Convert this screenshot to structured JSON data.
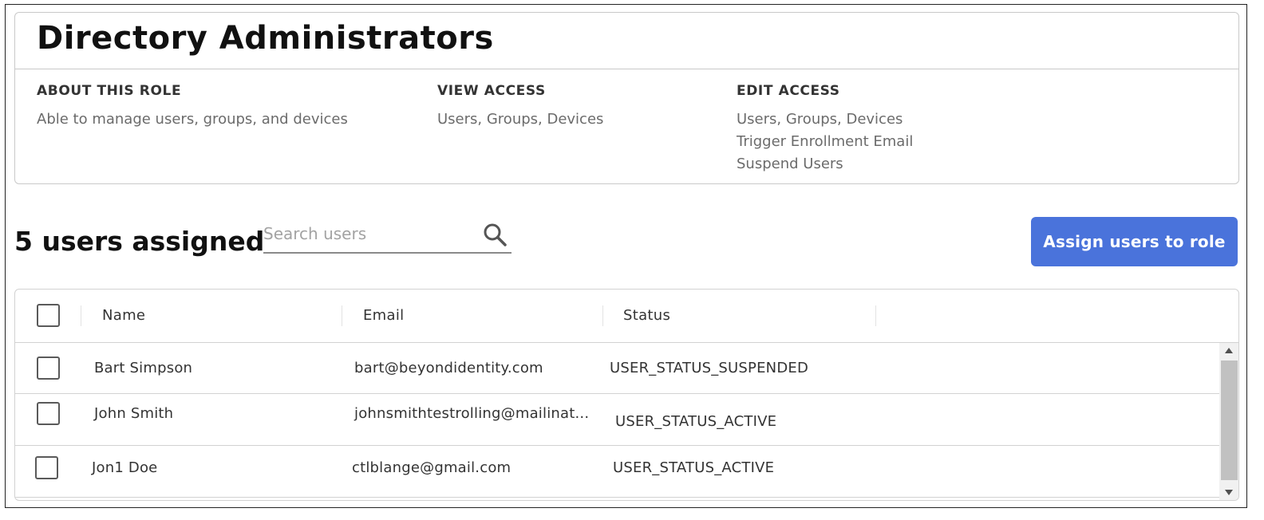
{
  "role": {
    "title": "Directory Administrators",
    "about": {
      "heading": "ABOUT THIS ROLE",
      "text": "Able to manage users, groups, and devices"
    },
    "view_access": {
      "heading": "VIEW ACCESS",
      "items": [
        "Users, Groups, Devices"
      ]
    },
    "edit_access": {
      "heading": "EDIT ACCESS",
      "items": [
        "Users, Groups, Devices",
        "Trigger Enrollment Email",
        "Suspend Users"
      ]
    }
  },
  "toolbar": {
    "users_count": "5 users assigned",
    "search_placeholder": "Search users",
    "search_value": "",
    "search_icon": "search-icon",
    "assign_label": "Assign users to role"
  },
  "table": {
    "headers": {
      "name": "Name",
      "email": "Email",
      "status": "Status"
    },
    "rows": [
      {
        "name": "Bart Simpson",
        "email": "bart@beyondidentity.com",
        "status": "USER_STATUS_SUSPENDED"
      },
      {
        "name": "John Smith",
        "email": "johnsmithtestrolling@mailinat...",
        "status": "USER_STATUS_ACTIVE"
      },
      {
        "name": "Jon1 Doe",
        "email": "ctlblange@gmail.com",
        "status": "USER_STATUS_ACTIVE"
      }
    ]
  },
  "colors": {
    "accent": "#4a73db",
    "border": "#d2d2d2",
    "muted_text": "#6b6b6b"
  }
}
